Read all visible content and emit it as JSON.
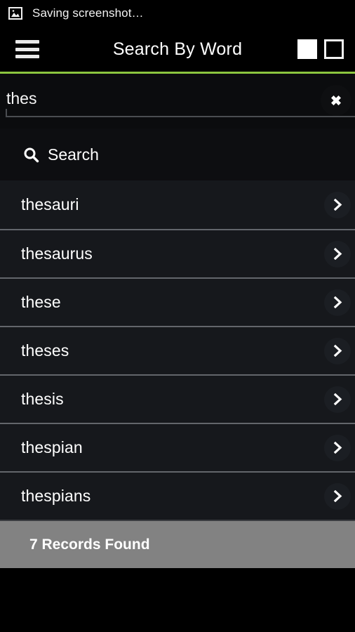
{
  "statusbar": {
    "icon": "image-icon",
    "text": "Saving screenshot…"
  },
  "appbar": {
    "menu_icon": "hamburger-menu-icon",
    "title": "Search By Word",
    "action_filled_label": "",
    "action_outline_label": "",
    "accent_color": "#8cc63f"
  },
  "search": {
    "value": "thes",
    "placeholder": "",
    "clear_icon": "close-icon"
  },
  "section": {
    "icon": "search-icon",
    "label": "Search"
  },
  "results": [
    {
      "label": "thesauri",
      "chevron": "chevron-right-icon"
    },
    {
      "label": "thesaurus",
      "chevron": "chevron-right-icon"
    },
    {
      "label": "these",
      "chevron": "chevron-right-icon"
    },
    {
      "label": "theses",
      "chevron": "chevron-right-icon"
    },
    {
      "label": "thesis",
      "chevron": "chevron-right-icon"
    },
    {
      "label": "thespian",
      "chevron": "chevron-right-icon"
    },
    {
      "label": "thespians",
      "chevron": "chevron-right-icon"
    }
  ],
  "footer": {
    "records_text": "7 Records Found"
  }
}
